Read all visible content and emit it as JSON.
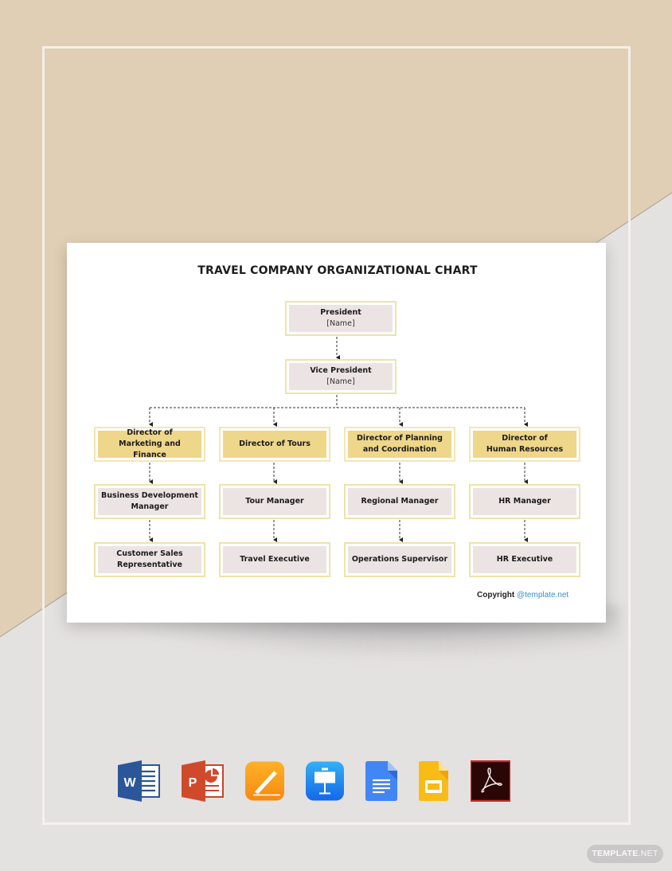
{
  "chart": {
    "title": "TRAVEL COMPANY ORGANIZATIONAL CHART",
    "president": {
      "title": "President",
      "name": "[Name]"
    },
    "vice_president": {
      "title": "Vice President",
      "name": "[Name]"
    },
    "departments": [
      {
        "director": "Director of Marketing and Finance",
        "manager": "Business Development Manager",
        "staff": "Customer Sales Representative"
      },
      {
        "director": "Director of Tours",
        "manager": "Tour Manager",
        "staff": "Travel Executive"
      },
      {
        "director": "Director of Planning and Coordination",
        "manager": "Regional Manager",
        "staff": "Operations Supervisor"
      },
      {
        "director": "Director of Human Resources",
        "manager": "HR Manager",
        "staff": "HR Executive"
      }
    ]
  },
  "copyright": {
    "label": "Copyright",
    "link": "@template.net"
  },
  "formats": [
    {
      "name": "Microsoft Word",
      "icon": "word-icon"
    },
    {
      "name": "Microsoft PowerPoint",
      "icon": "powerpoint-icon"
    },
    {
      "name": "Apple Pages",
      "icon": "pages-icon"
    },
    {
      "name": "Apple Keynote",
      "icon": "keynote-icon"
    },
    {
      "name": "Google Docs",
      "icon": "google-docs-icon"
    },
    {
      "name": "Google Slides",
      "icon": "google-slides-icon"
    },
    {
      "name": "Adobe PDF",
      "icon": "adobe-pdf-icon"
    }
  ],
  "badge": {
    "bold": "TEMPLATE",
    "light": ".NET"
  },
  "colors": {
    "background_top": "#e0cfb5",
    "background_bottom": "#e4e1e1",
    "director_fill": "#eed68a",
    "node_fill": "#ece4e3",
    "node_border": "#efe2ab",
    "link": "#3a8fc9"
  }
}
